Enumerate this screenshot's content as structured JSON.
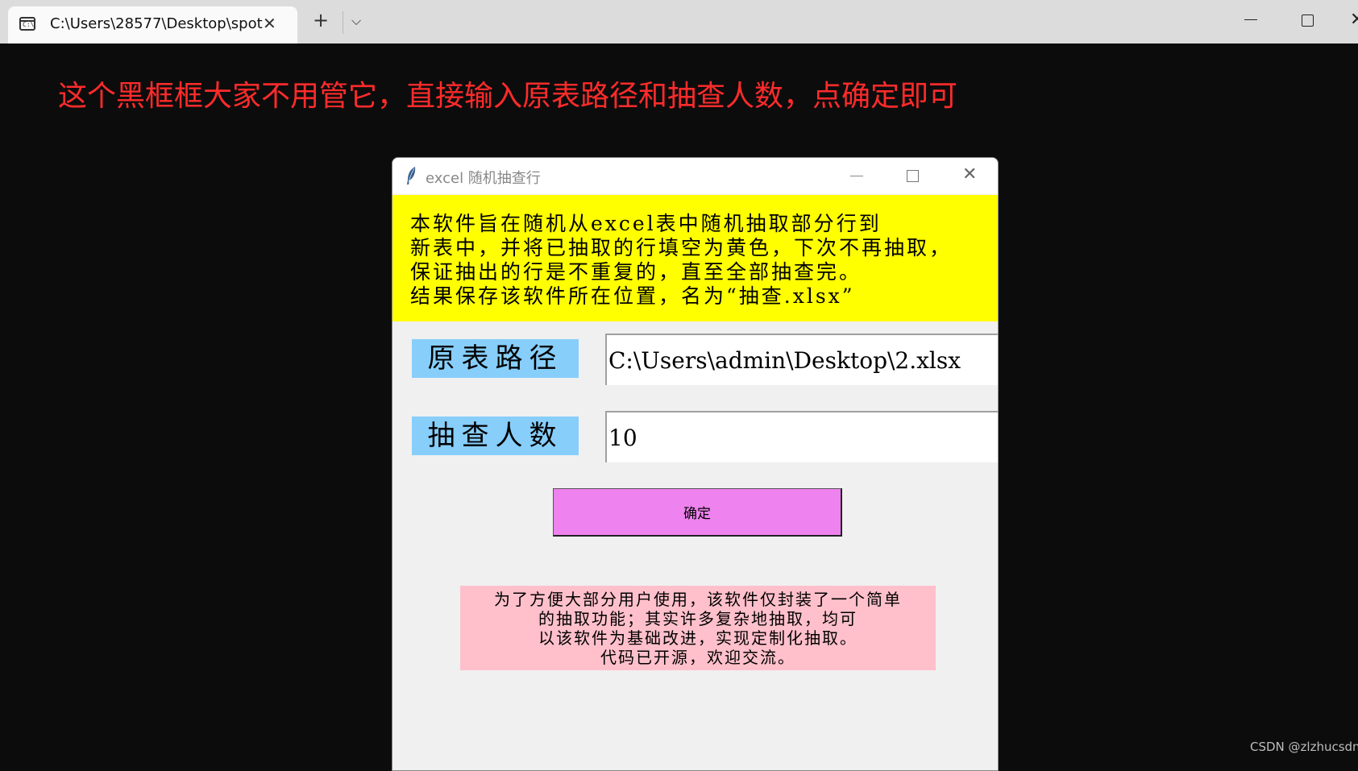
{
  "terminal": {
    "tab_title": "C:\\Users\\28577\\Desktop\\spot",
    "tab_icon_text": "C:\\",
    "close_glyph": "✕",
    "new_tab_glyph": "+",
    "dropdown_glyph": "⌵"
  },
  "annotation": {
    "text": "这个黑框框大家不用管它，直接输入原表路径和抽查人数，点确定即可",
    "color": "#ff2b2b"
  },
  "app_window": {
    "title": "excel 随机抽查行",
    "close_glyph": "✕",
    "info_lines": [
      "本软件旨在随机从excel表中随机抽取部分行到",
      "新表中，并将已抽取的行填空为黄色，下次不再抽取，",
      "保证抽出的行是不重复的，直至全部抽查完。",
      " 结果保存该软件所在位置，名为“抽查.xlsx”"
    ],
    "path_label": "原表路径",
    "path_value": "C:\\Users\\admin\\Desktop\\2.xlsx",
    "count_label": "抽查人数",
    "count_value": "10",
    "confirm_label": "确定",
    "note_lines": [
      "为了方便大部分用户使用，该软件仅封装了一个简单",
      "的抽取功能；其实许多复杂地抽取，均可",
      "以该软件为基础改进，实现定制化抽取。",
      "代码已开源，欢迎交流。"
    ],
    "colors": {
      "info_bg": "#ffff00",
      "label_bg": "#87cefa",
      "button_bg": "#ee82ee",
      "note_bg": "#ffc0cb"
    }
  },
  "watermark": "CSDN @zlzhucsdn"
}
